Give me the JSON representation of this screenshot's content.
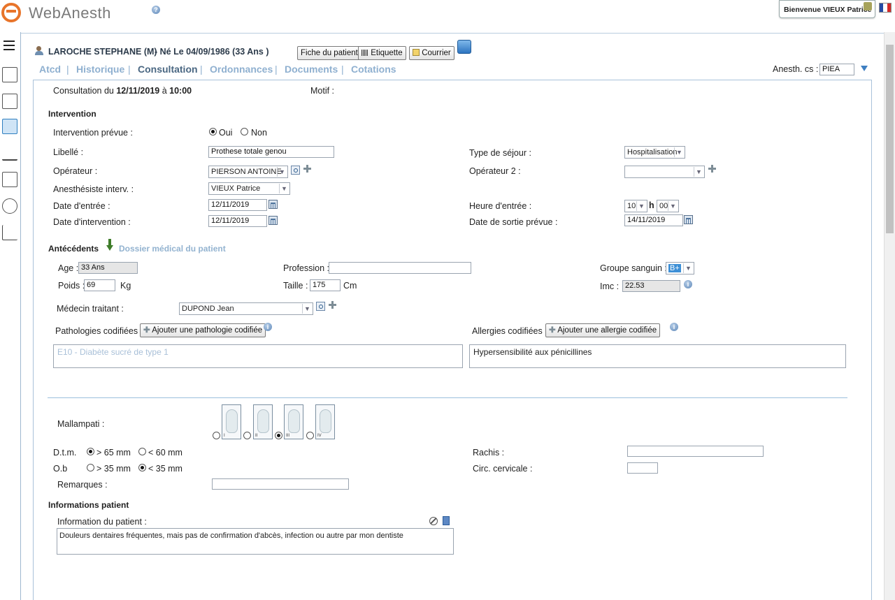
{
  "app": {
    "name": "WebAnesth",
    "welcome": "Bienvenue VIEUX Patrice"
  },
  "patient": {
    "name": "LAROCHE STEPHANE (M)",
    "birth": "-  Né  Le  04/09/1986 (33 Ans )",
    "btn_fiche": "Fiche du patient",
    "btn_etiquette": "Etiquette",
    "btn_courrier": "Courrier"
  },
  "tabs": [
    "Atcd",
    "Historique",
    "Consultation",
    "Ordonnances",
    "Documents",
    "Cotations"
  ],
  "active_tab": "Consultation",
  "anesth": {
    "label": "Anesth. cs :",
    "value": "PIEA"
  },
  "consultation": {
    "prefix": "Consultation du",
    "date": "12/11/2019",
    "at": "à",
    "time": "10:00",
    "motif_label": "Motif :"
  },
  "intervention": {
    "title": "Intervention",
    "prevue_label": "Intervention prévue :",
    "oui": "Oui",
    "non": "Non",
    "libelle_label": "Libellé :",
    "libelle": "Prothese totale genou",
    "operateur_label": "Opérateur :",
    "operateur": "PIERSON ANTOINE",
    "anesthesiste_label": "Anesthésiste interv. :",
    "anesthesiste": "VIEUX Patrice",
    "date_entree_label": "Date d'entrée :",
    "date_entree": "12/11/2019",
    "date_intervention_label": "Date d'intervention :",
    "date_intervention": "12/11/2019",
    "type_sejour_label": "Type de séjour :",
    "type_sejour": "Hospitalisation",
    "operateur2_label": "Opérateur 2 :",
    "operateur2": "",
    "heure_entree_label": "Heure d'entrée :",
    "heure": "10",
    "h": "h",
    "minute": "00",
    "date_sortie_label": "Date de sortie prévue :",
    "date_sortie": "14/11/2019"
  },
  "antecedents": {
    "title": "Antécédents",
    "dossier_link": "Dossier médical du patient",
    "age_label": "Age :",
    "age": "33 Ans",
    "profession_label": "Profession :",
    "profession": "",
    "groupe_label": "Groupe sanguin :",
    "groupe": "B+",
    "poids_label": "Poids :",
    "poids": "69",
    "poids_unit": "Kg",
    "taille_label": "Taille :",
    "taille": "175",
    "taille_unit": "Cm",
    "imc_label": "Imc :",
    "imc": "22.53",
    "medecin_label": "Médecin traitant :",
    "medecin": "DUPOND Jean",
    "pathologies_label": "Pathologies codifiées :",
    "add_pathologie": "Ajouter une pathologie codifiée",
    "allergies_label": "Allergies codifiées :",
    "add_allergie": "Ajouter une allergie codifiée",
    "pathologie_item": "E10 - Diabète sucré de type 1",
    "allergie_item": "Hypersensibilité aux pénicillines"
  },
  "exam": {
    "mallampati_label": "Mallampati :",
    "mallampati_classes": [
      "I",
      "II",
      "III",
      "IV"
    ],
    "mallampati_selected": "III",
    "dtm_label": "D.t.m.",
    "dtm_opt1": "> 65 mm",
    "dtm_opt2": "< 60 mm",
    "ob_label": "O.b",
    "ob_opt1": "> 35 mm",
    "ob_opt2": "< 35 mm",
    "remarques_label": "Remarques :",
    "remarques": "",
    "rachis_label": "Rachis :",
    "rachis": "",
    "circ_label": "Circ. cervicale :",
    "circ": ""
  },
  "info_patient": {
    "title": "Informations patient",
    "label": "Information du patient :",
    "text": "Douleurs dentaires fréquentes, mais pas de confirmation d'abcès, infection ou autre par mon dentiste"
  }
}
